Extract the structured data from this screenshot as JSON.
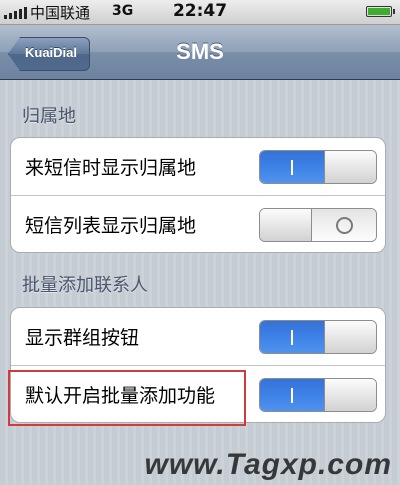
{
  "status_bar": {
    "carrier": "中国联通",
    "network": "3G",
    "time": "22:47",
    "battery_level": 1.0
  },
  "nav": {
    "back_label": "KuaiDial",
    "title": "SMS"
  },
  "sections": [
    {
      "header": "归属地",
      "rows": [
        {
          "label": "来短信时显示归属地",
          "on": true
        },
        {
          "label": "短信列表显示归属地",
          "on": false
        }
      ]
    },
    {
      "header": "批量添加联系人",
      "rows": [
        {
          "label": "显示群组按钮",
          "on": true
        },
        {
          "label": "默认开启批量添加功能",
          "on": true
        }
      ]
    }
  ],
  "watermark": "www.Tagxp.com",
  "colors": {
    "switch_on": "#3d80e6",
    "nav_bar": "#8ea0b7",
    "highlight": "#d23b3b"
  }
}
